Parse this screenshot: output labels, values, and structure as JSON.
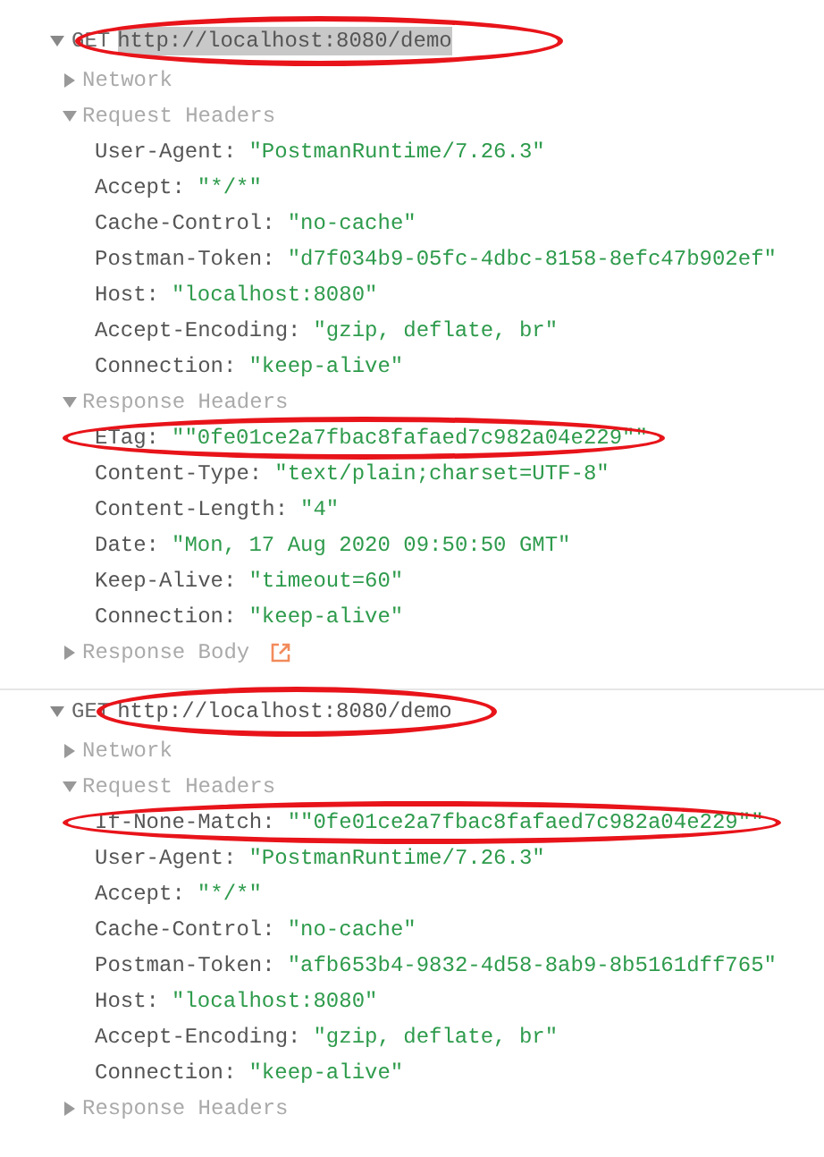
{
  "requests": [
    {
      "method": "GET",
      "url": "http://localhost:8080/demo",
      "expanded": true,
      "url_highlighted": true,
      "url_circled": true,
      "sections": [
        {
          "title": "Network",
          "expanded": false
        },
        {
          "title": "Request Headers",
          "expanded": true,
          "headers": [
            {
              "name": "User-Agent:",
              "value": "\"PostmanRuntime/7.26.3\"",
              "circled": false
            },
            {
              "name": "Accept:",
              "value": "\"*/*\"",
              "circled": false
            },
            {
              "name": "Cache-Control:",
              "value": "\"no-cache\"",
              "circled": false
            },
            {
              "name": "Postman-Token:",
              "value": "\"d7f034b9-05fc-4dbc-8158-8efc47b902ef\"",
              "circled": false
            },
            {
              "name": "Host:",
              "value": "\"localhost:8080\"",
              "circled": false
            },
            {
              "name": "Accept-Encoding:",
              "value": "\"gzip, deflate, br\"",
              "circled": false
            },
            {
              "name": "Connection:",
              "value": "\"keep-alive\"",
              "circled": false
            }
          ]
        },
        {
          "title": "Response Headers",
          "expanded": true,
          "headers": [
            {
              "name": "ETag:",
              "value": "\"\"0fe01ce2a7fbac8fafaed7c982a04e229\"\"",
              "circled": true
            },
            {
              "name": "Content-Type:",
              "value": "\"text/plain;charset=UTF-8\"",
              "circled": false
            },
            {
              "name": "Content-Length:",
              "value": "\"4\"",
              "circled": false
            },
            {
              "name": "Date:",
              "value": "\"Mon, 17 Aug 2020 09:50:50 GMT\"",
              "circled": false
            },
            {
              "name": "Keep-Alive:",
              "value": "\"timeout=60\"",
              "circled": false
            },
            {
              "name": "Connection:",
              "value": "\"keep-alive\"",
              "circled": false
            }
          ]
        },
        {
          "title": "Response Body",
          "expanded": false,
          "open_link": true
        }
      ]
    },
    {
      "method": "GET",
      "url": "http://localhost:8080/demo",
      "expanded": true,
      "url_highlighted": false,
      "url_circled": true,
      "sections": [
        {
          "title": "Network",
          "expanded": false
        },
        {
          "title": "Request Headers",
          "expanded": true,
          "headers": [
            {
              "name": "If-None-Match:",
              "value": "\"\"0fe01ce2a7fbac8fafaed7c982a04e229\"\"",
              "circled": true
            },
            {
              "name": "User-Agent:",
              "value": "\"PostmanRuntime/7.26.3\"",
              "circled": false
            },
            {
              "name": "Accept:",
              "value": "\"*/*\"",
              "circled": false
            },
            {
              "name": "Cache-Control:",
              "value": "\"no-cache\"",
              "circled": false
            },
            {
              "name": "Postman-Token:",
              "value": "\"afb653b4-9832-4d58-8ab9-8b5161dff765\"",
              "circled": false
            },
            {
              "name": "Host:",
              "value": "\"localhost:8080\"",
              "circled": false
            },
            {
              "name": "Accept-Encoding:",
              "value": "\"gzip, deflate, br\"",
              "circled": false
            },
            {
              "name": "Connection:",
              "value": "\"keep-alive\"",
              "circled": false
            }
          ]
        },
        {
          "title": "Response Headers",
          "expanded": false
        }
      ]
    }
  ]
}
